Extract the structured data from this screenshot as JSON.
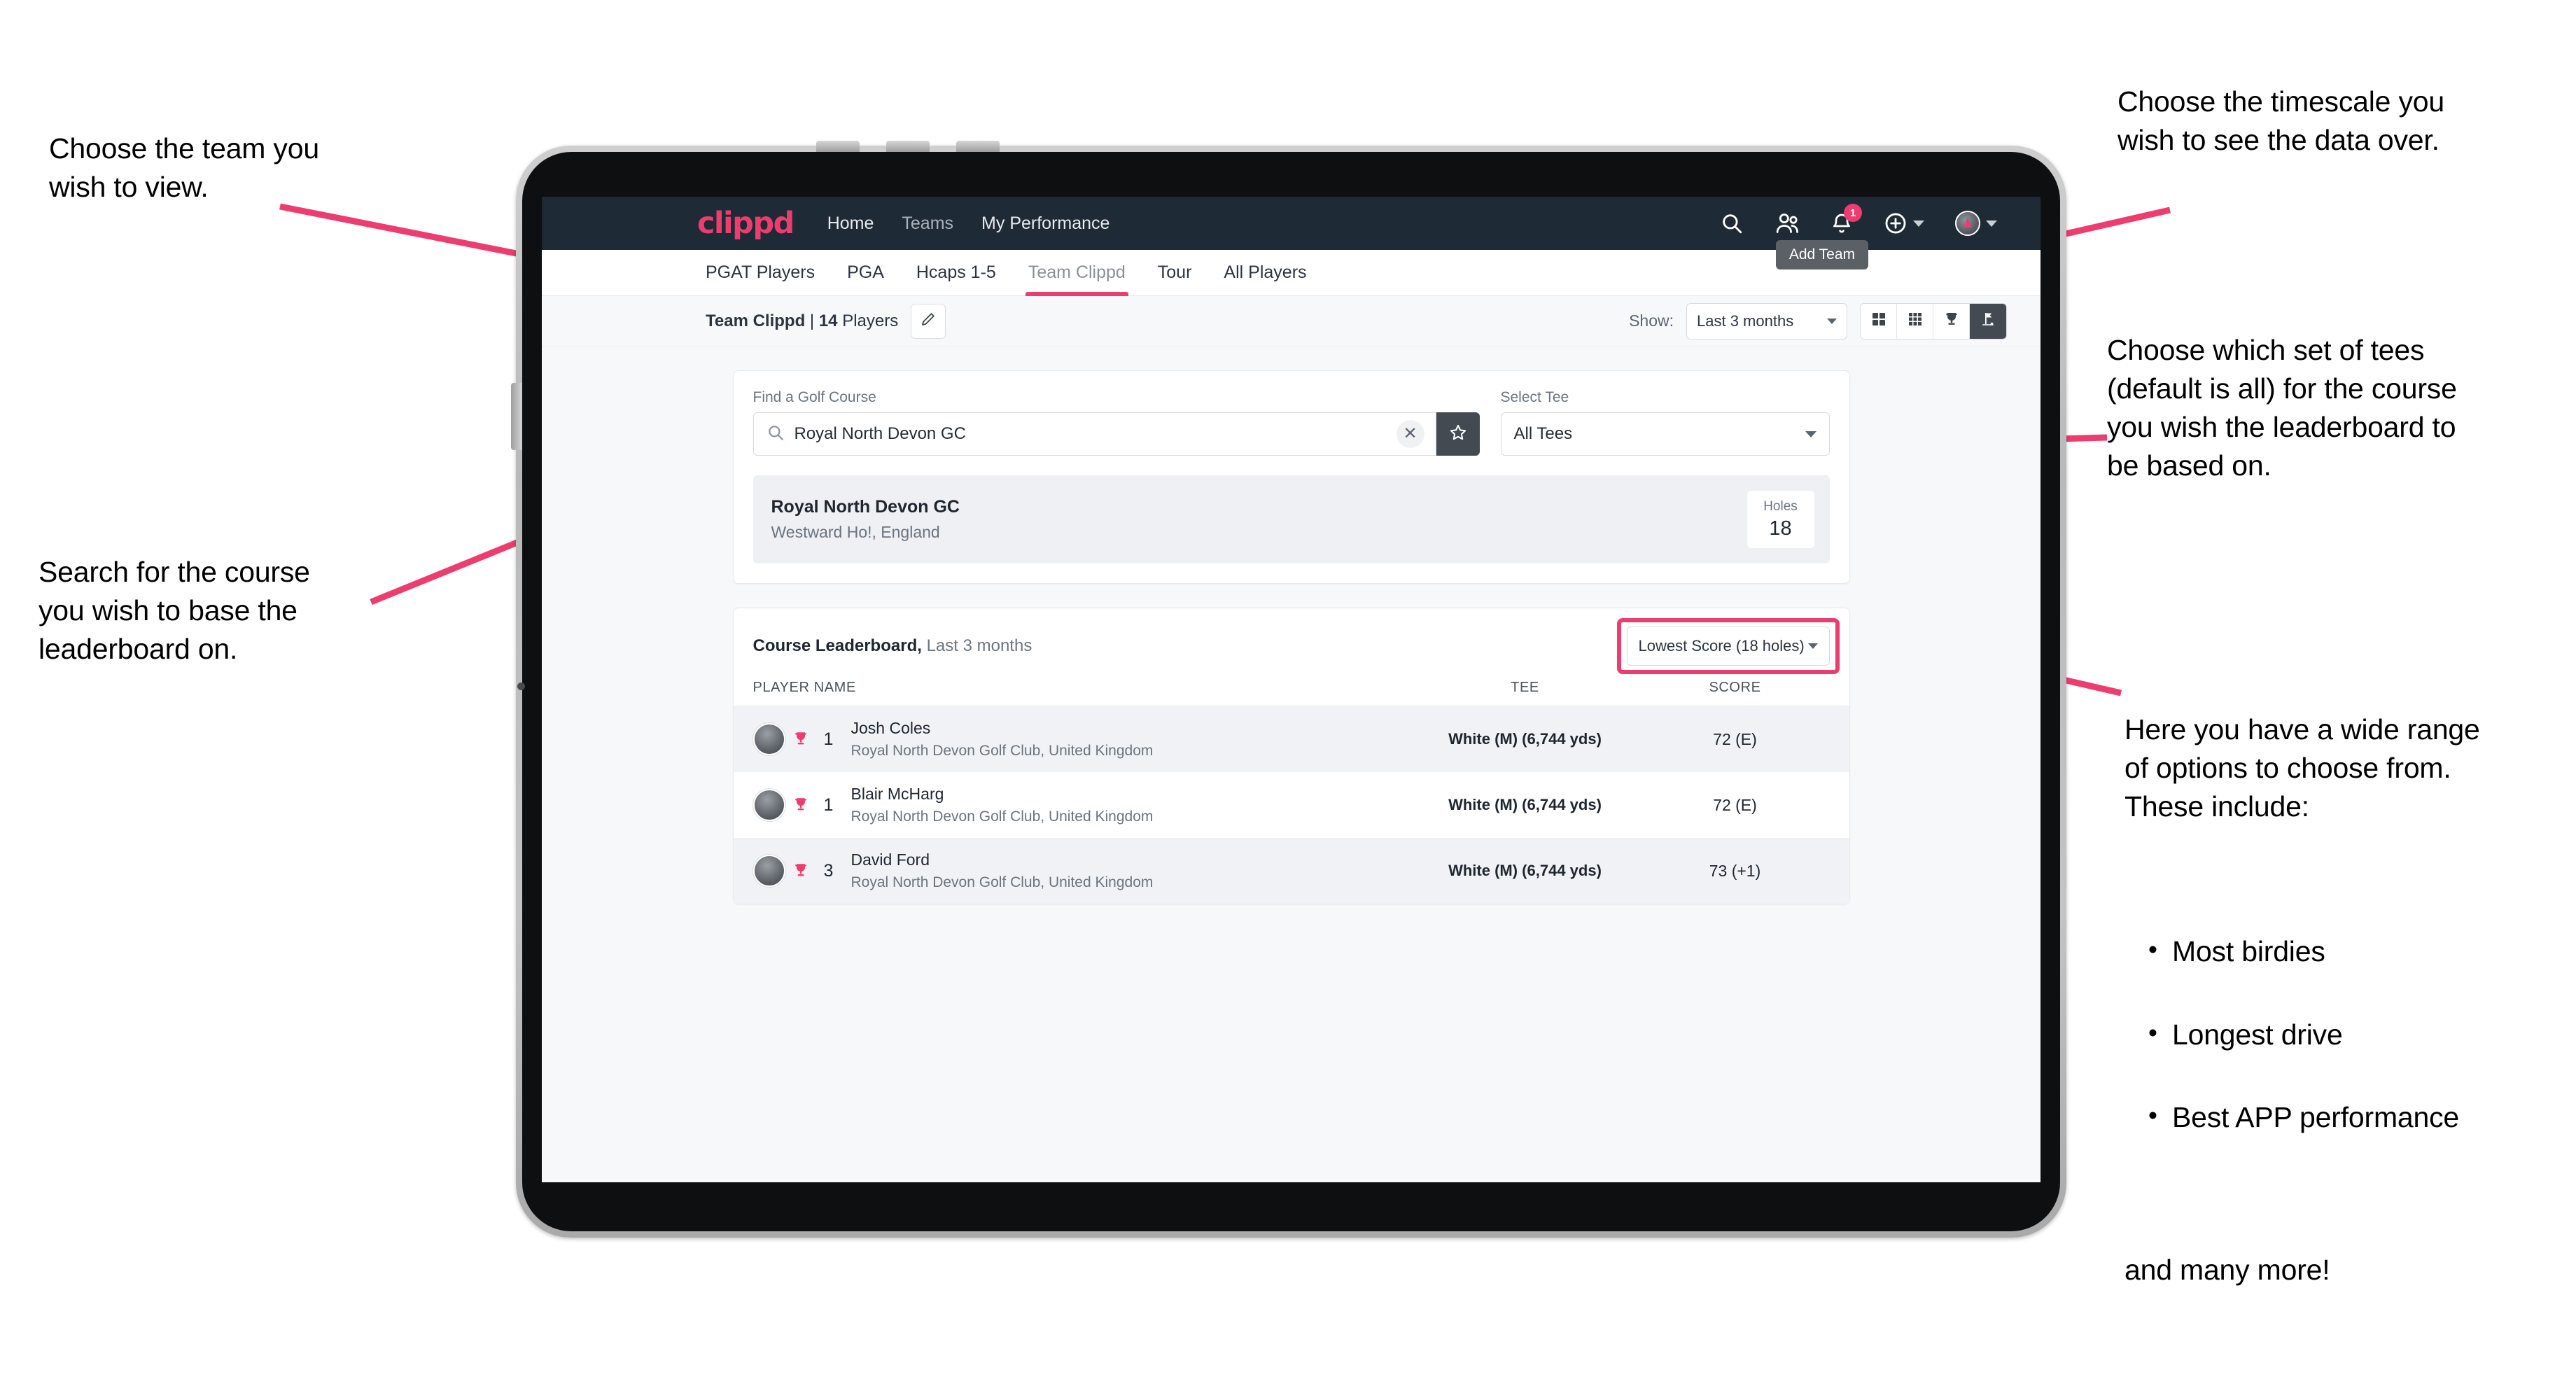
{
  "annotations": {
    "top_left": "Choose the team you\nwish to view.",
    "mid_left": "Search for the course\nyou wish to base the\nleaderboard on.",
    "top_right": "Choose the timescale you\nwish to see the data over.",
    "mid_right": "Choose which set of tees\n(default is all) for the course\nyou wish the leaderboard to\nbe based on.",
    "bottom_right_intro": "Here you have a wide range\nof options to choose from.\nThese include:",
    "bottom_right_items": [
      "Most birdies",
      "Longest drive",
      "Best APP performance"
    ],
    "bottom_right_tail": "and many more!",
    "bullet_glyph": "•",
    "arrow_color": "#ec3d6e"
  },
  "topnav": {
    "brand": "clippd",
    "links": [
      {
        "label": "Home",
        "dim": false
      },
      {
        "label": "Teams",
        "dim": true
      },
      {
        "label": "My Performance",
        "dim": false
      }
    ],
    "icons": [
      {
        "name": "search-icon"
      },
      {
        "name": "people-icon"
      },
      {
        "name": "bell-icon",
        "badge": "1"
      },
      {
        "name": "plus-circle-icon"
      },
      {
        "name": "avatar-icon"
      }
    ],
    "notification_count": "1",
    "tooltip": "Add Team",
    "bg_color": "#1e2a35",
    "accent_color": "#ec3d6e"
  },
  "tabs": [
    {
      "label": "PGAT Players",
      "active": false
    },
    {
      "label": "PGA",
      "active": false
    },
    {
      "label": "Hcaps 1-5",
      "active": false
    },
    {
      "label": "Team Clippd",
      "active": true
    },
    {
      "label": "Tour",
      "active": false
    },
    {
      "label": "All Players",
      "active": false
    }
  ],
  "subbar": {
    "team_name": "Team Clippd",
    "separator": " | ",
    "player_count": "14",
    "players_word": "Players",
    "edit_icon": "pencil-icon",
    "show_label": "Show:",
    "timescale_value": "Last 3 months",
    "view_modes": [
      {
        "name": "grid-2x2-icon",
        "active": false
      },
      {
        "name": "grid-3x3-icon",
        "active": false
      },
      {
        "name": "trophy-icon",
        "active": false
      },
      {
        "name": "golf-flag-icon",
        "active": true
      }
    ]
  },
  "search_card": {
    "course_label": "Find a Golf Course",
    "course_value": "Royal North Devon GC",
    "course_placeholder": "Find a Golf Course",
    "clear_icon": "close-icon",
    "search_icon": "search-icon",
    "favourite_icon": "star-icon",
    "tee_label": "Select Tee",
    "tee_value": "All Tees",
    "result": {
      "name": "Royal North Devon GC",
      "location": "Westward Ho!, England",
      "holes_label": "Holes",
      "holes_value": "18"
    }
  },
  "leaderboard": {
    "title": "Course Leaderboard,",
    "subtitle": " Last 3 months",
    "metric_value": "Lowest Score (18 holes)",
    "columns": {
      "player": "PLAYER NAME",
      "tee": "TEE",
      "score": "SCORE"
    },
    "rows": [
      {
        "rank": "1",
        "name": "Josh Coles",
        "club": "Royal North Devon Golf Club, United Kingdom",
        "tee": "White (M) (6,744 yds)",
        "score": "72 (E)",
        "trophy": "trophy-icon"
      },
      {
        "rank": "1",
        "name": "Blair McHarg",
        "club": "Royal North Devon Golf Club, United Kingdom",
        "tee": "White (M) (6,744 yds)",
        "score": "72 (E)",
        "trophy": "trophy-icon"
      },
      {
        "rank": "3",
        "name": "David Ford",
        "club": "Royal North Devon Golf Club, United Kingdom",
        "tee": "White (M) (6,744 yds)",
        "score": "73 (+1)",
        "trophy": "trophy-icon"
      }
    ]
  }
}
